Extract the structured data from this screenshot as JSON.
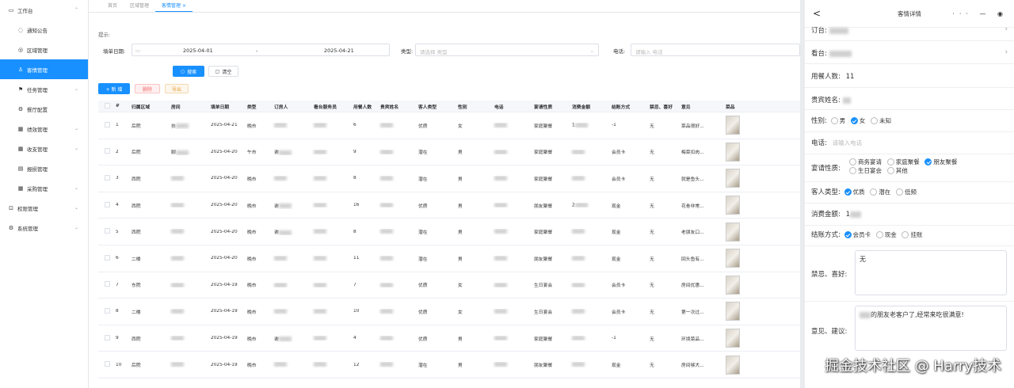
{
  "sidebar": {
    "items": [
      {
        "icon": "monitor",
        "label": "工作台",
        "sub": false,
        "active": false,
        "chev": "up"
      },
      {
        "icon": "bell",
        "label": "通知公告",
        "sub": true,
        "active": false,
        "chev": ""
      },
      {
        "icon": "pin",
        "label": "区域管理",
        "sub": true,
        "active": false,
        "chev": ""
      },
      {
        "icon": "user",
        "label": "客情管理",
        "sub": true,
        "active": true,
        "chev": ""
      },
      {
        "icon": "flag",
        "label": "任务管理",
        "sub": true,
        "active": false,
        "chev": "down"
      },
      {
        "icon": "gear",
        "label": "餐厅配置",
        "sub": true,
        "active": false,
        "chev": ""
      },
      {
        "icon": "grid",
        "label": "绩效管理",
        "sub": true,
        "active": false,
        "chev": "down"
      },
      {
        "icon": "grid",
        "label": "收支管理",
        "sub": true,
        "active": false,
        "chev": "down"
      },
      {
        "icon": "doc",
        "label": "报损管理",
        "sub": true,
        "active": false,
        "chev": ""
      },
      {
        "icon": "grid",
        "label": "采购管理",
        "sub": true,
        "active": false,
        "chev": "down"
      },
      {
        "icon": "lock",
        "label": "权限管理",
        "sub": false,
        "active": false,
        "chev": "down"
      },
      {
        "icon": "gear",
        "label": "系统管理",
        "sub": false,
        "active": false,
        "chev": "down"
      }
    ]
  },
  "tabs": [
    {
      "label": "首页",
      "active": false
    },
    {
      "label": "区域管理",
      "active": false
    },
    {
      "label": "客情管理",
      "active": true,
      "close": "×"
    }
  ],
  "tip": "提示:",
  "form": {
    "date_label": "填单日期:",
    "date_start": "2025-04-01",
    "date_sep": "-",
    "date_end": "2025-04-21",
    "type_label": "类型:",
    "type_placeholder": "请选择 类型",
    "phone_label": "电话:",
    "phone_placeholder": "请输入 电话",
    "search_btn": "搜索",
    "clear_btn": "清空"
  },
  "toolbar": {
    "add": "+ 新 增",
    "delete": "删除",
    "export": "导出"
  },
  "table": {
    "headers": [
      "#",
      "归属区域",
      "房间",
      "填单日期",
      "类型",
      "订房人",
      "看台服务员",
      "用餐人数",
      "贵宾姓名",
      "客人类型",
      "性别",
      "电话",
      "宴请性质",
      "消费金额",
      "结账方式",
      "禁忌、喜好",
      "意见",
      "菜品"
    ],
    "rows": [
      [
        "1",
        "后院",
        "扶",
        "2025-04-21",
        "晚市",
        "",
        "",
        "6",
        "",
        "优质",
        "女",
        "",
        "家庭聚餐",
        "1",
        "-1",
        "无",
        "菜品很好..."
      ],
      [
        "2",
        "后院",
        "脚",
        "2025-04-20",
        "午市",
        "谢",
        "",
        "9",
        "",
        "潜在",
        "男",
        "",
        "家庭聚餐",
        "",
        "会员卡",
        "无",
        "梅菜扣肉..."
      ],
      [
        "3",
        "西院",
        "",
        "2025-04-20",
        "晚市",
        "",
        "",
        "8",
        "",
        "潜在",
        "男",
        "",
        "家庭聚餐",
        "",
        "会员卡",
        "无",
        "就是鱼头..."
      ],
      [
        "4",
        "西院",
        "",
        "2025-04-20",
        "晚市",
        "谢",
        "",
        "16",
        "",
        "优质",
        "男",
        "",
        "朋友聚餐",
        "2",
        "现金",
        "无",
        "花卷非常..."
      ],
      [
        "5",
        "西院",
        "",
        "2025-04-20",
        "晚市",
        "谢",
        "",
        "8",
        "",
        "潜在",
        "男",
        "",
        "家庭聚餐",
        "",
        "现金",
        "无",
        "老朋友口..."
      ],
      [
        "6",
        "二楼",
        "",
        "2025-04-20",
        "晚市",
        "",
        "",
        "11",
        "",
        "潜在",
        "男",
        "",
        "朋友聚餐",
        "",
        "现金",
        "无",
        "回头鱼有..."
      ],
      [
        "7",
        "东院",
        "",
        "2025-04-19",
        "晚市",
        "",
        "",
        "7",
        "",
        "优质",
        "女",
        "",
        "生日宴会",
        "",
        "会员卡",
        "无",
        "房间优惠..."
      ],
      [
        "8",
        "二楼",
        "",
        "2025-04-19",
        "晚市",
        "",
        "",
        "10",
        "",
        "优质",
        "女",
        "",
        "生日宴会",
        "",
        "会员卡",
        "无",
        "第一次过..."
      ],
      [
        "9",
        "西院",
        "",
        "2025-04-19",
        "晚市",
        "谢",
        "",
        "4",
        "",
        "优质",
        "男",
        "",
        "家庭聚餐",
        "",
        "-1",
        "无",
        "环境菜品..."
      ],
      [
        "10",
        "后院",
        "",
        "2025-04-19",
        "晚市",
        "",
        "",
        "12",
        "",
        "潜在",
        "男",
        "",
        "朋友聚餐",
        "",
        "现金",
        "无",
        "房间够大..."
      ]
    ]
  },
  "panel": {
    "title": "客情详情",
    "back": "<",
    "fields": {
      "room_label": "订台:",
      "stand_label": "看台:",
      "diners_label": "用餐人数:",
      "diners_value": "11",
      "guest_label": "贵宾姓名:",
      "gender_label": "性别:",
      "gender_opts": [
        "男",
        "女",
        "未知"
      ],
      "phone_label": "电话:",
      "phone_placeholder": "请输入电话",
      "nature_label": "宴请性质:",
      "nature_opts": [
        "商务宴请",
        "家庭聚餐",
        "朋友聚餐",
        "生日宴会",
        "其他"
      ],
      "ctype_label": "客人类型:",
      "ctype_opts": [
        "优质",
        "潜在",
        "低频"
      ],
      "amount_label": "消费金额:",
      "amount_value": "1",
      "pay_label": "结账方式:",
      "pay_opts": [
        "会员卡",
        "现金",
        "挂账"
      ],
      "taboo_label": "禁忌、喜好:",
      "taboo_value": "无",
      "opinion_label": "意见、建议:",
      "opinion_value": "的朋友老客户了,经常来吃很满意!"
    }
  },
  "watermark": "掘金技术社区 @ Harry技术",
  "colors": {
    "accent": "#1890ff",
    "danger": "#f56c6c",
    "warning": "#e6a23c"
  }
}
